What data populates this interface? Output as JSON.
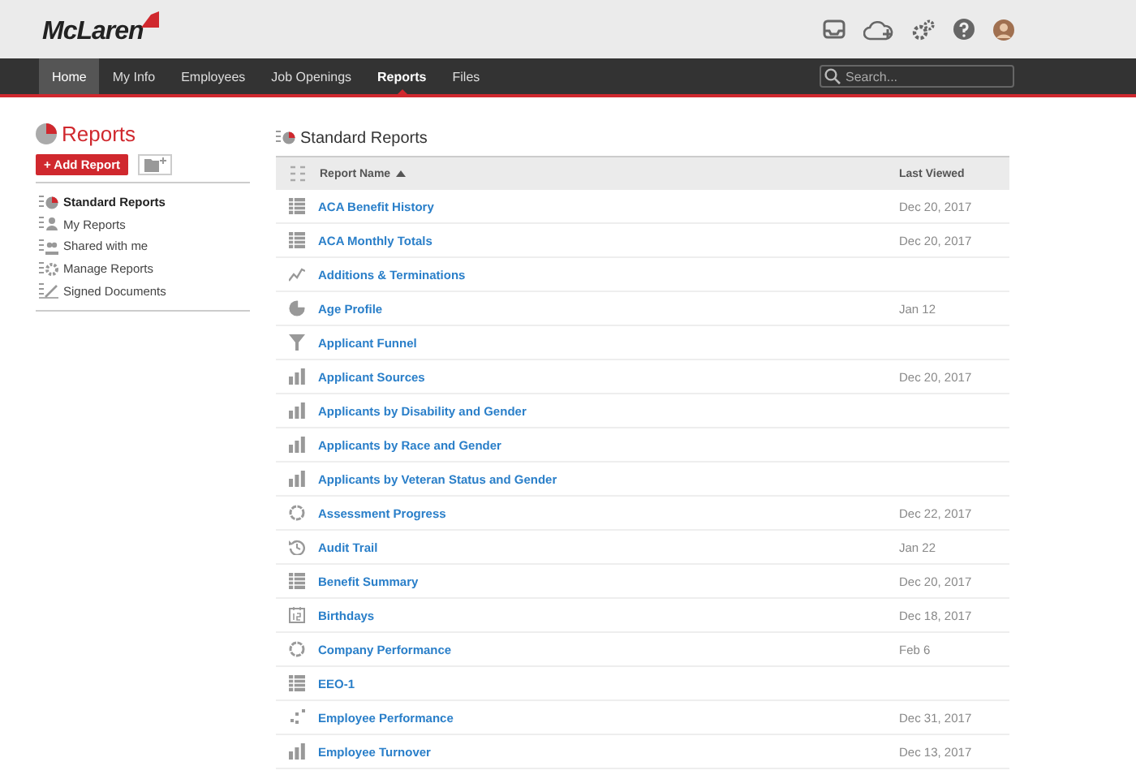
{
  "header": {
    "logo": "McLaren"
  },
  "nav": {
    "items": [
      {
        "label": "Home",
        "selected": false,
        "hovered": true
      },
      {
        "label": "My Info",
        "selected": false,
        "hovered": false
      },
      {
        "label": "Employees",
        "selected": false,
        "hovered": false
      },
      {
        "label": "Job Openings",
        "selected": false,
        "hovered": false
      },
      {
        "label": "Reports",
        "selected": true,
        "hovered": false
      },
      {
        "label": "Files",
        "selected": false,
        "hovered": false
      }
    ],
    "search": {
      "placeholder": "Search..."
    }
  },
  "sidebar": {
    "title": "Reports",
    "add_button": "+ Add Report",
    "items": [
      {
        "label": "Standard Reports",
        "kind": "standard",
        "selected": true
      },
      {
        "label": "My Reports",
        "kind": "mine",
        "selected": false
      },
      {
        "label": "Shared with me",
        "kind": "shared",
        "selected": false
      },
      {
        "label": "Manage Reports",
        "kind": "manage",
        "selected": false
      },
      {
        "label": "Signed Documents",
        "kind": "signed",
        "selected": false
      }
    ]
  },
  "main": {
    "title": "Standard Reports",
    "columns": [
      {
        "label": "Report Name",
        "sorted": true
      },
      {
        "label": "Last Viewed",
        "sorted": false
      }
    ],
    "rows": [
      {
        "kind": "table",
        "name": "ACA Benefit History",
        "last_viewed": "Dec 20, 2017"
      },
      {
        "kind": "table",
        "name": "ACA Monthly Totals",
        "last_viewed": "Dec 20, 2017"
      },
      {
        "kind": "line",
        "name": "Additions & Terminations"
      },
      {
        "kind": "pie",
        "name": "Age Profile",
        "last_viewed": "Jan 12"
      },
      {
        "kind": "funnel",
        "name": "Applicant Funnel"
      },
      {
        "kind": "bar",
        "name": "Applicant Sources",
        "last_viewed": "Dec 20, 2017"
      },
      {
        "kind": "bar",
        "name": "Applicants by Disability and Gender"
      },
      {
        "kind": "bar",
        "name": "Applicants by Race and Gender"
      },
      {
        "kind": "bar",
        "name": "Applicants by Veteran Status and Gender"
      },
      {
        "kind": "ring",
        "name": "Assessment Progress",
        "last_viewed": "Dec 22, 2017"
      },
      {
        "kind": "history",
        "name": "Audit Trail",
        "last_viewed": "Jan 22"
      },
      {
        "kind": "table",
        "name": "Benefit Summary",
        "last_viewed": "Dec 20, 2017"
      },
      {
        "kind": "calendar",
        "name": "Birthdays",
        "last_viewed": "Dec 18, 2017"
      },
      {
        "kind": "ring",
        "name": "Company Performance",
        "last_viewed": "Feb 6"
      },
      {
        "kind": "table",
        "name": "EEO-1"
      },
      {
        "kind": "scatter",
        "name": "Employee Performance",
        "last_viewed": "Dec 31, 2017"
      },
      {
        "kind": "bar",
        "name": "Employee Turnover",
        "last_viewed": "Dec 13, 2017"
      }
    ]
  }
}
